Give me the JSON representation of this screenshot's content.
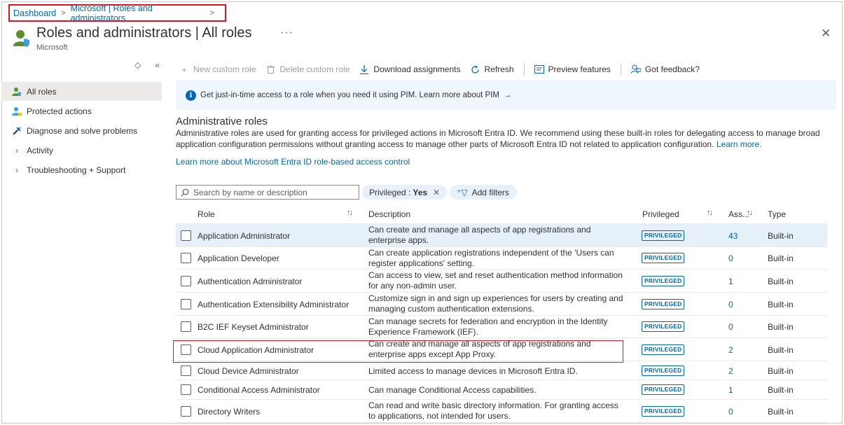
{
  "breadcrumb": {
    "home": "Dashboard",
    "current": "Microsoft | Roles and administrators"
  },
  "header": {
    "title": "Roles and administrators | All roles",
    "subtitle": "Microsoft",
    "more": "···",
    "close": "✕"
  },
  "sidebar": {
    "items": [
      {
        "label": "All roles",
        "icon": "user-shield-icon",
        "active": true
      },
      {
        "label": "Protected actions",
        "icon": "user-lock-icon",
        "active": false
      },
      {
        "label": "Diagnose and solve problems",
        "icon": "wrench-icon",
        "active": false
      },
      {
        "label": "Activity",
        "icon": "chevron-right-icon",
        "active": false
      },
      {
        "label": "Troubleshooting + Support",
        "icon": "chevron-right-icon",
        "active": false
      }
    ]
  },
  "toolbar": {
    "new_custom_role": "New custom role",
    "delete_custom_role": "Delete custom role",
    "download_assignments": "Download assignments",
    "refresh": "Refresh",
    "preview_features": "Preview features",
    "got_feedback": "Got feedback?"
  },
  "banner": {
    "text": "Get just-in-time access to a role when you need it using PIM. Learn more about PIM"
  },
  "section": {
    "title": "Administrative roles",
    "description": "Administrative roles are used for granting access for privileged actions in Microsoft Entra ID. We recommend using these built-in roles for delegating access to manage broad application configuration permissions without granting access to manage other parts of Microsoft Entra ID not related to application configuration.",
    "learn_more": "Learn more.",
    "rbac_link": "Learn more about Microsoft Entra ID role-based access control"
  },
  "filters": {
    "search_placeholder": "Search by name or description",
    "privileged_label": "Privileged :",
    "privileged_value": "Yes",
    "add_filters": "Add filters"
  },
  "table": {
    "columns": {
      "role": "Role",
      "description": "Description",
      "privileged": "Privileged",
      "assignments": "Ass...",
      "type": "Type"
    },
    "badge": "PRIVILEGED",
    "rows": [
      {
        "role": "Application Administrator",
        "description": "Can create and manage all aspects of app registrations and enterprise apps.",
        "assignments": "43",
        "type": "Built-in"
      },
      {
        "role": "Application Developer",
        "description": "Can create application registrations independent of the 'Users can register applications' setting.",
        "assignments": "0",
        "type": "Built-in"
      },
      {
        "role": "Authentication Administrator",
        "description": "Can access to view, set and reset authentication method information for any non-admin user.",
        "assignments": "1",
        "type": "Built-in"
      },
      {
        "role": "Authentication Extensibility Administrator",
        "description": "Customize sign in and sign up experiences for users by creating and managing custom authentication extensions.",
        "assignments": "0",
        "type": "Built-in"
      },
      {
        "role": "B2C IEF Keyset Administrator",
        "description": "Can manage secrets for federation and encryption in the Identity Experience Framework (IEF).",
        "assignments": "0",
        "type": "Built-in"
      },
      {
        "role": "Cloud Application Administrator",
        "description": "Can create and manage all aspects of app registrations and enterprise apps except App Proxy.",
        "assignments": "2",
        "type": "Built-in"
      },
      {
        "role": "Cloud Device Administrator",
        "description": "Limited access to manage devices in Microsoft Entra ID.",
        "assignments": "2",
        "type": "Built-in"
      },
      {
        "role": "Conditional Access Administrator",
        "description": "Can manage Conditional Access capabilities.",
        "assignments": "1",
        "type": "Built-in"
      },
      {
        "role": "Directory Writers",
        "description": "Can read and write basic directory information. For granting access to applications, not intended for users.",
        "assignments": "0",
        "type": "Built-in"
      }
    ]
  },
  "colors": {
    "accent": "#0067b8",
    "highlight_box": "#e81123",
    "banner_bg": "#eff6fc",
    "row_selected_bg": "#e6f0f9"
  }
}
